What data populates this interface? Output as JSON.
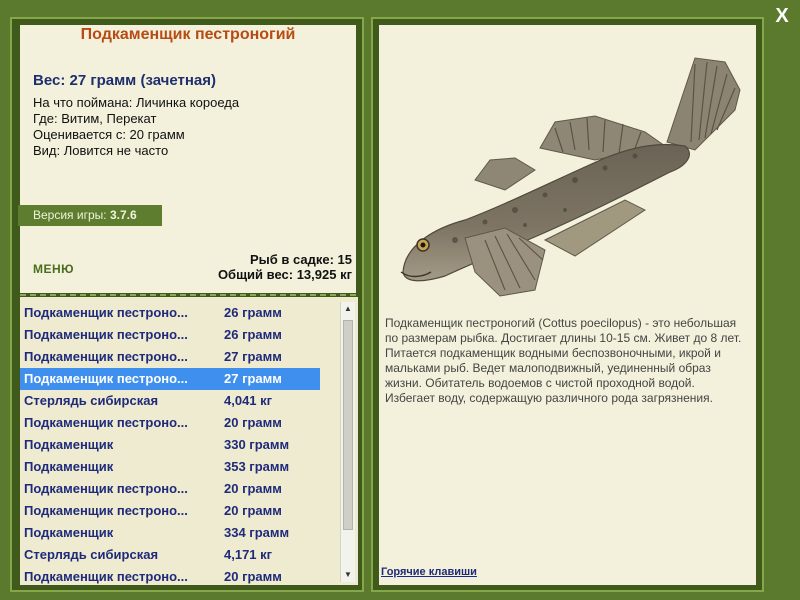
{
  "window": {
    "close_label": "X"
  },
  "fish": {
    "title": "Подкаменщик пестроногий",
    "weight_line": "Вес: 27 грамм (зачетная)",
    "details": [
      "На что поймана: Личинка короеда",
      "Где: Витим, Перекат",
      "Оценивается с: 20 грамм",
      "Вид: Ловится не часто"
    ],
    "description": "Подкаменщик пестроногий (Cottus poecilopus) - это небольшая по размерам рыбка. Достигает длины 10-15 см. Живет до 8 лет. Питается подкаменщик водными беспозвоночными, икрой и мальками рыб. Ведет малоподвижный, уединенный образ жизни. Обитатель водоемов с чистой проходной водой. Избегает воду, содержащую различного рода загрязнения."
  },
  "version": {
    "label": "Версия игры:",
    "value": "3.7.6"
  },
  "menu": {
    "label": "МЕНЮ"
  },
  "stats": {
    "fish_count": "Рыб в садке: 15",
    "total_weight": "Общий вес: 13,925 кг"
  },
  "catch_list": [
    {
      "name": "Подкаменщик пестроно...",
      "weight": "26 грамм"
    },
    {
      "name": "Подкаменщик пестроно...",
      "weight": "26 грамм"
    },
    {
      "name": "Подкаменщик пестроно...",
      "weight": "27 грамм"
    },
    {
      "name": "Подкаменщик пестроно...",
      "weight": "27 грамм"
    },
    {
      "name": "Стерлядь сибирская",
      "weight": "4,041 кг"
    },
    {
      "name": "Подкаменщик пестроно...",
      "weight": "20 грамм"
    },
    {
      "name": "Подкаменщик",
      "weight": "330 грамм"
    },
    {
      "name": "Подкаменщик",
      "weight": "353 грамм"
    },
    {
      "name": "Подкаменщик пестроно...",
      "weight": "20 грамм"
    },
    {
      "name": "Подкаменщик пестроно...",
      "weight": "20 грамм"
    },
    {
      "name": "Подкаменщик",
      "weight": "334 грамм"
    },
    {
      "name": "Стерлядь сибирская",
      "weight": "4,171 кг"
    },
    {
      "name": "Подкаменщик пестроно...",
      "weight": "20 грамм"
    }
  ],
  "selected_row": 3,
  "hotkeys": {
    "label": "Горячие клавиши"
  },
  "colors": {
    "background": "#5c7a2e",
    "panel": "#f3f1db",
    "title_accent": "#b84a14",
    "list_text": "#1f2a7a",
    "selection": "#3f8fef"
  },
  "icons": {
    "close": "close-icon",
    "scroll_up": "scroll-up-arrow-icon",
    "scroll_down": "scroll-down-arrow-icon"
  }
}
